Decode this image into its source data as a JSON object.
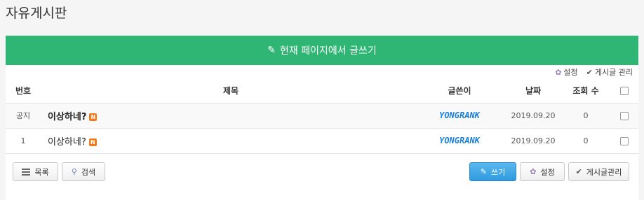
{
  "page": {
    "title": "자유게시판"
  },
  "write_bar": {
    "label": "현재 페이지에서 글쓰기"
  },
  "admin": {
    "settings": "설정",
    "manage": "게시글 관리"
  },
  "table": {
    "headers": {
      "no": "번호",
      "title": "제목",
      "author": "글쓴이",
      "date": "날짜",
      "views": "조회 수"
    },
    "rows": [
      {
        "no": "공지",
        "title": "이상하네?",
        "badge": "N",
        "author": "YONGRANK",
        "date": "2019.09.20",
        "views": "0",
        "notice": true
      },
      {
        "no": "1",
        "title": "이상하네?",
        "badge": "N",
        "author": "YONGRANK",
        "date": "2019.09.20",
        "views": "0",
        "notice": false
      }
    ]
  },
  "buttons": {
    "list": "목록",
    "search": "검색",
    "write": "쓰기",
    "settings": "설정",
    "manage": "게시글관리"
  },
  "colors": {
    "accent": "#2fb574",
    "primary": "#2f9be0",
    "badge": "#f07a1a",
    "logo": "#1a7fd4"
  }
}
